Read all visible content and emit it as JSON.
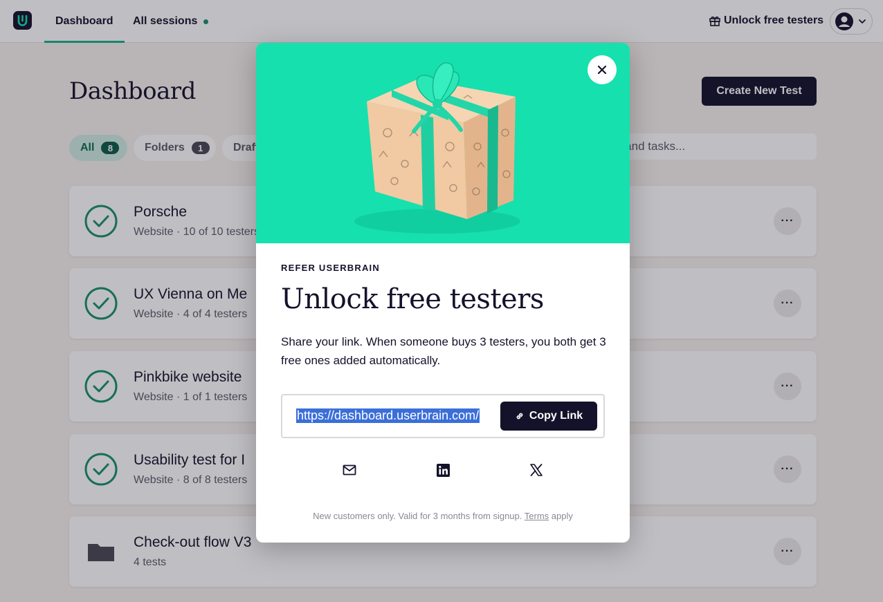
{
  "nav": {
    "tabs": [
      {
        "label": "Dashboard"
      },
      {
        "label": "All sessions"
      }
    ],
    "unlock_label": "Unlock free testers"
  },
  "page": {
    "title": "Dashboard",
    "create_button": "Create New Test",
    "filters": [
      {
        "label": "All",
        "count": "8"
      },
      {
        "label": "Folders",
        "count": "1"
      },
      {
        "label": "Draft"
      }
    ],
    "search_visible_text": "RL, and tasks..."
  },
  "tests": [
    {
      "title": "Porsche",
      "subtitle": "Website · 10 of 10 testers",
      "status": "completed"
    },
    {
      "title": "UX Vienna on Me",
      "subtitle": "Website · 4 of 4 testers",
      "status": "completed"
    },
    {
      "title": "Pinkbike website",
      "subtitle": "Website · 1 of 1 testers",
      "status": "completed"
    },
    {
      "title": "Usability test for I",
      "subtitle": "Website · 8 of 8 testers",
      "status": "completed"
    },
    {
      "title": "Check-out flow V3",
      "subtitle": "4 tests",
      "status": "folder"
    }
  ],
  "modal": {
    "eyebrow": "REFER USERBRAIN",
    "title": "Unlock free testers",
    "description": "Share your link. When someone buys 3 testers, you both get 3 free ones added automatically.",
    "link": "https://dashboard.userbrain.com/",
    "copy_button": "Copy Link",
    "share_icons": [
      "mail-icon",
      "linkedin-icon",
      "x-icon"
    ],
    "fineprint_prefix": "New customers only. Valid for 3 months from signup.",
    "fineprint_terms": "Terms",
    "fineprint_suffix": "apply"
  },
  "colors": {
    "brand_dark": "#14122b",
    "accent_green": "#16b08c",
    "hero_green": "#16e0ae",
    "selection_blue": "#3b6fd8"
  }
}
